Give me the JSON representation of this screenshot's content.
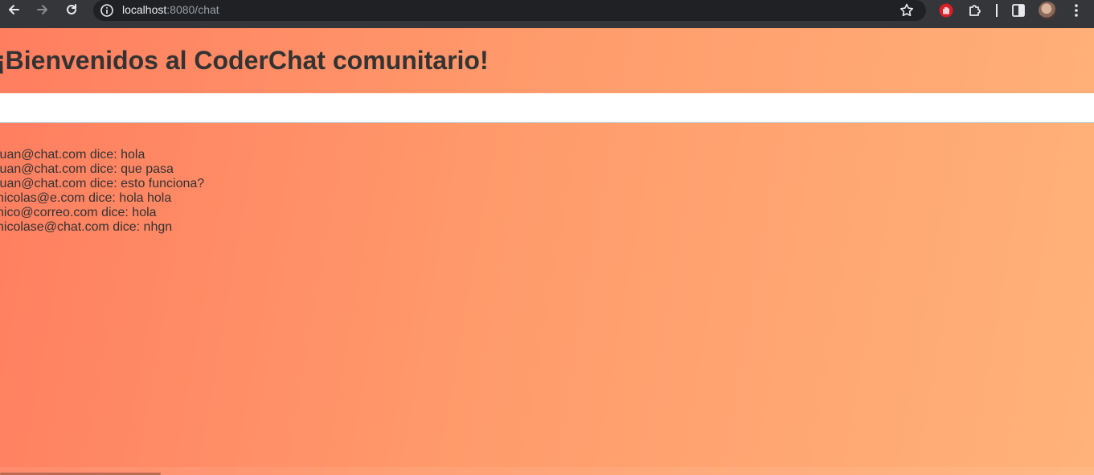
{
  "browser": {
    "url_host": "localhost",
    "url_path": ":8080/chat"
  },
  "page": {
    "title": "¡Bienvenidos al CoderChat comunitario!",
    "chat_input": {
      "value": "",
      "placeholder": ""
    },
    "messages": [
      {
        "text": "juan@chat.com dice: hola"
      },
      {
        "text": "juan@chat.com dice: que pasa"
      },
      {
        "text": "juan@chat.com dice: esto funciona?"
      },
      {
        "text": "nicolas@e.com dice: hola hola"
      },
      {
        "text": "nico@correo.com dice: hola"
      },
      {
        "text": "nicolase@chat.com dice: nhgn"
      }
    ]
  },
  "colors": {
    "background_start": "#ff7e60",
    "background_end": "#ffb27a",
    "text": "#333333"
  }
}
